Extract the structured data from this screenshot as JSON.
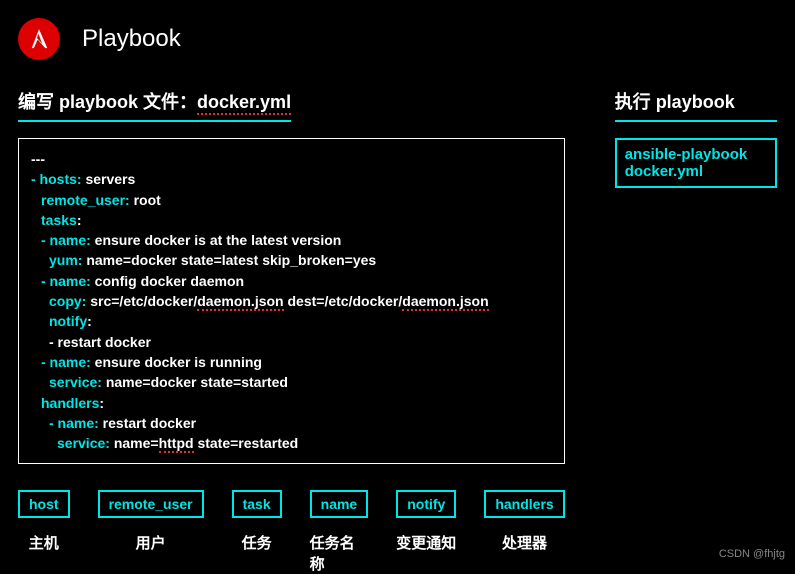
{
  "header": {
    "title": "Playbook"
  },
  "left": {
    "title_prefix": "编写 playbook 文件：",
    "filename": "docker.yml",
    "code": {
      "l1": "---",
      "l2_key": "- hosts:",
      "l2_val": " servers",
      "l3_key": "remote_user:",
      "l3_val": " root",
      "l4_key": "tasks",
      "l4_colon": ":",
      "l5_key": "- name:",
      "l5_val": " ensure docker is at the latest version",
      "l6_key": "yum:",
      "l6_val": " name=docker state=latest skip_broken=yes",
      "l7_key": "- name:",
      "l7_val": " config docker daemon",
      "l8_key": "copy:",
      "l8_val1": " src=/etc/docker/",
      "l8_u1": "daemon.json",
      "l8_val2": " dest=/etc/docker/",
      "l8_u2": "daemon.json",
      "l9_key": "notify",
      "l9_colon": ":",
      "l10": "- restart docker",
      "l11_key": "- name:",
      "l11_val": " ensure docker is running",
      "l12_key": "service:",
      "l12_val": " name=docker state=started",
      "l13_key": "handlers",
      "l13_colon": ":",
      "l14_key": "- name:",
      "l14_val": " restart docker",
      "l15_key": "service:",
      "l15_val1": " name=",
      "l15_u": "httpd",
      "l15_val2": " state=restarted"
    }
  },
  "right": {
    "title": "执行 playbook",
    "command": "ansible-playbook docker.yml"
  },
  "legend": [
    {
      "tag": "host",
      "label": "主机"
    },
    {
      "tag": "remote_user",
      "label": "用户"
    },
    {
      "tag": "task",
      "label": "任务"
    },
    {
      "tag": "name",
      "label": "任务名称"
    },
    {
      "tag": "notify",
      "label": "变更通知"
    },
    {
      "tag": "handlers",
      "label": "处理器"
    }
  ],
  "watermark": "CSDN @fhjtg"
}
